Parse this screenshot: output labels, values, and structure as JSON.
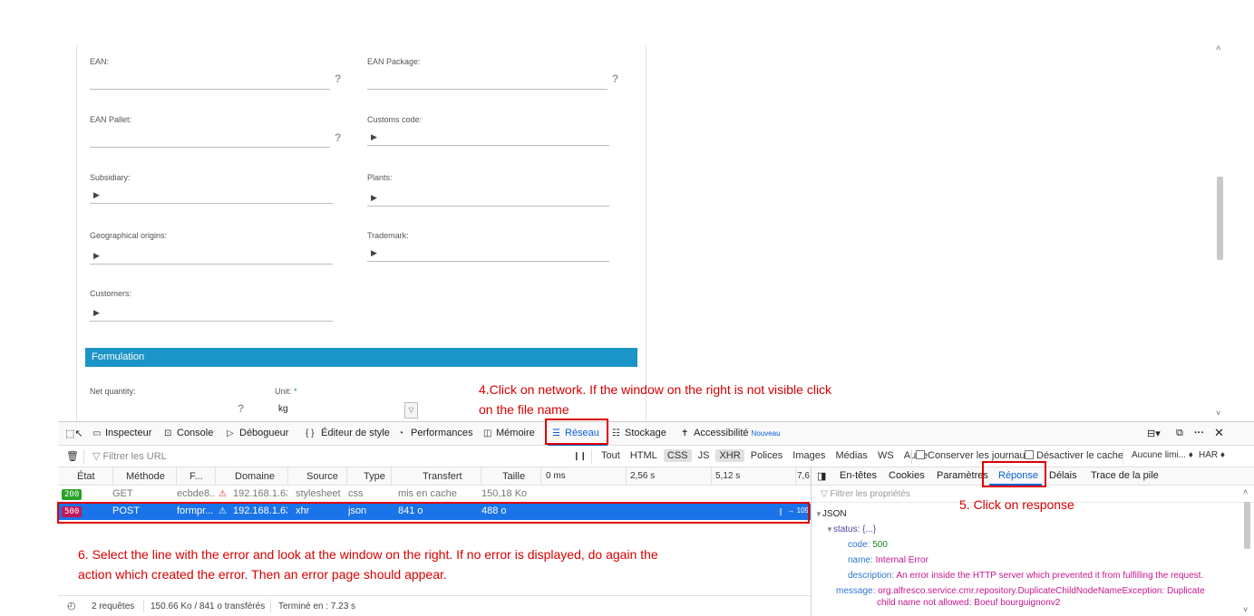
{
  "form": {
    "ean_label": "EAN:",
    "ean_package_label": "EAN Package:",
    "ean_pallet_label": "EAN Pallet:",
    "customs_code_label": "Customs code:",
    "subsidiary_label": "Subsidiary:",
    "plants_label": "Plants:",
    "geo_origins_label": "Geographical origins:",
    "trademark_label": "Trademark:",
    "customers_label": "Customers:",
    "help_mark": "?",
    "expand_mark": "▶",
    "section_formulation": "Formulation",
    "net_quantity_label": "Net quantity:",
    "unit_label": "Unit:",
    "required_star": "*",
    "unit_value": "kg"
  },
  "annotations": {
    "step4_line1": "4.Click on network. If the window on the right is not visible click",
    "step4_line2": "on the file name",
    "step5": "5. Click on response",
    "step6_line1": "6. Select the line with the error and look at the window on the right. If no error is displayed, do again the",
    "step6_line2": "action which created the error. Then an error page should appear."
  },
  "devtools": {
    "tabs": {
      "inspector": "Inspecteur",
      "console": "Console",
      "debugger": "Débogueur",
      "style_editor": "Éditeur de style",
      "performance": "Performances",
      "memory": "Mémoire",
      "network": "Réseau",
      "storage": "Stockage",
      "accessibility": "Accessibilité",
      "new_badge": "Nouveau"
    },
    "filter": {
      "url_placeholder": "Filtrer les URL",
      "pause": "❙❙",
      "types": [
        "Tout",
        "HTML",
        "CSS",
        "JS",
        "XHR",
        "Polices",
        "Images",
        "Médias",
        "WS",
        "Autre"
      ],
      "persist_logs": "Conserver les journaux",
      "disable_cache": "Désactiver le cache",
      "throttling": "Aucune limi... ♦",
      "har": "HAR ♦"
    },
    "columns": {
      "status": "État",
      "method": "Méthode",
      "file": "F...",
      "domain": "Domaine",
      "source": "Source",
      "type": "Type",
      "transfer": "Transfert",
      "size": "Taille",
      "t0": "0 ms",
      "t1": "2,56 s",
      "t2": "5,12 s",
      "t3": "7,6"
    },
    "requests": [
      {
        "status": "200",
        "method": "GET",
        "file": "ecbde8...",
        "domain": "192.168.1.63:...",
        "source": "stylesheet",
        "type": "css",
        "transfer": "mis en cache",
        "size": "150,18 Ko",
        "timing": ""
      },
      {
        "status": "500",
        "method": "POST",
        "file": "formpr...",
        "domain": "192.168.1.63:...",
        "source": "xhr",
        "type": "json",
        "transfer": "841 o",
        "size": "488 o",
        "timing": "→ 109"
      }
    ],
    "statusbar": {
      "requests": "2 requêtes",
      "transferred": "150.66 Ko / 841 o transférés",
      "finished": "Terminé en : 7.23 s"
    },
    "side": {
      "tabs": [
        "En-têtes",
        "Cookies",
        "Paramètres",
        "Réponse",
        "Délais",
        "Trace de la pile"
      ],
      "filter_placeholder": "Filtrer les propriétés",
      "json_root": "JSON",
      "status_key": "status: {...}",
      "code_key": "code:",
      "code_val": "500",
      "name_key": "name:",
      "name_val": "Internal Error",
      "desc_key": "description:",
      "desc_val": "An error inside the HTTP server which prevented it from fulfilling the request.",
      "message_key": "message:",
      "message_val1": "org.alfresco.service.cmr.repository.DuplicateChildNodeNameException: Duplicate",
      "message_val2": "child name not allowed: Boeuf bourguignonv2"
    }
  }
}
